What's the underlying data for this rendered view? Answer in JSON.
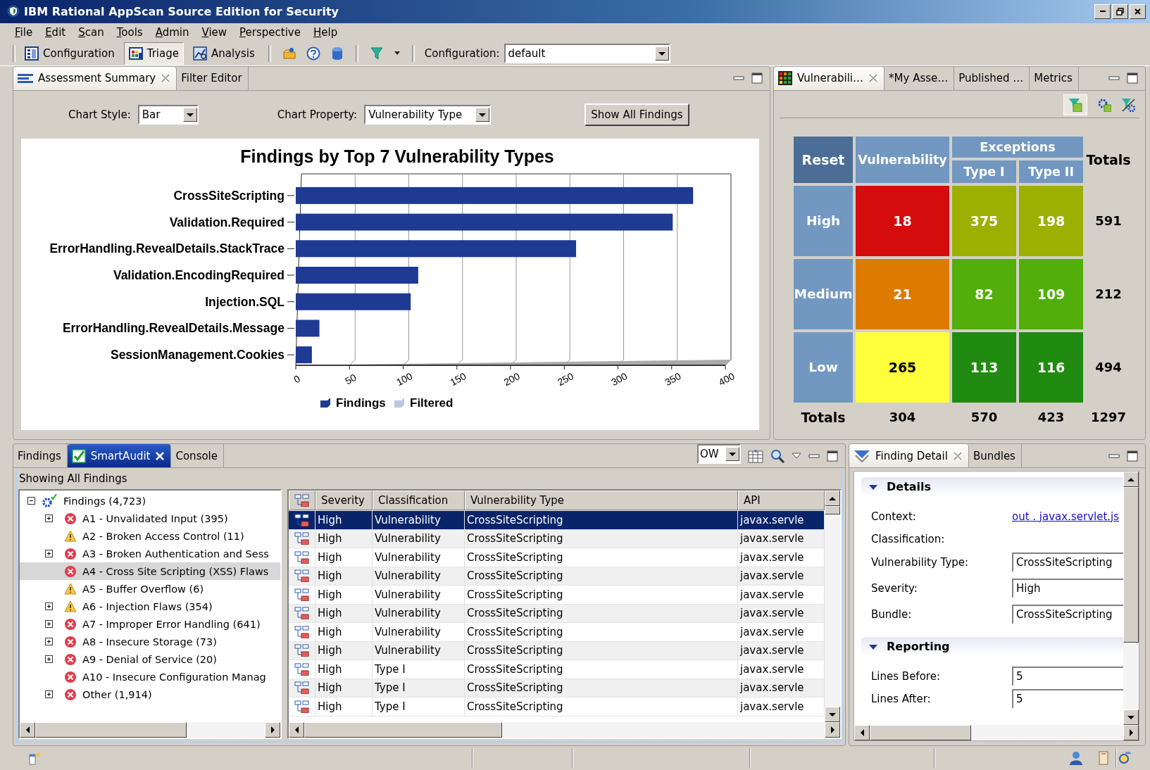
{
  "window": {
    "title": "IBM Rational AppScan Source Edition for Security"
  },
  "menu": [
    "File",
    "Edit",
    "Scan",
    "Tools",
    "Admin",
    "View",
    "Perspective",
    "Help"
  ],
  "toolbar": {
    "perspectives": [
      {
        "label": "Configuration",
        "kind": "configuration",
        "selected": false
      },
      {
        "label": "Triage",
        "kind": "triage",
        "selected": true
      },
      {
        "label": "Analysis",
        "kind": "analysis",
        "selected": false
      }
    ],
    "configuration_label": "Configuration:",
    "configuration_value": "default"
  },
  "summary_panel": {
    "active": false,
    "tabs": [
      {
        "label": "Assessment Summary",
        "selected": true,
        "closable": true
      },
      {
        "label": "Filter Editor",
        "selected": false,
        "closable": false
      }
    ],
    "chart_style_label": "Chart Style:",
    "chart_style": "Bar",
    "chart_property_label": "Chart Property:",
    "chart_property": "Vulnerability Type",
    "show_all_button": "Show All Findings",
    "chart_data": {
      "type": "bar",
      "orientation": "horizontal",
      "title": "Findings by Top 7 Vulnerability Types",
      "categories": [
        "CrossSiteScripting",
        "Validation.Required",
        "ErrorHandling.RevealDetails.StackTrace",
        "Validation.EncodingRequired",
        "Injection.SQL",
        "ErrorHandling.RevealDetails.Message",
        "SessionManagement.Cookies"
      ],
      "series": [
        {
          "name": "Findings",
          "color": "#1f3a93",
          "values": [
            370,
            351,
            261,
            114,
            107,
            22,
            15
          ]
        },
        {
          "name": "Filtered",
          "color": "#b9c6e6",
          "values": [
            0,
            0,
            0,
            0,
            0,
            0,
            0
          ]
        }
      ],
      "xlim": [
        0,
        400
      ],
      "xticks": [
        0,
        50,
        100,
        150,
        200,
        250,
        300,
        350,
        400
      ]
    }
  },
  "matrix_panel": {
    "active": false,
    "tabs": [
      {
        "label": "Vulnerabili…",
        "selected": true,
        "closable": true
      },
      {
        "label": "*My Asse…",
        "selected": false,
        "closable": false
      },
      {
        "label": "Published …",
        "selected": false,
        "closable": false
      },
      {
        "label": "Metrics",
        "selected": false,
        "closable": false
      }
    ],
    "matrix": {
      "reset": "Reset",
      "vulnerability": "Vulnerability",
      "exceptions": "Exceptions",
      "type_1": "Type I",
      "type_2": "Type II",
      "totals": "Totals",
      "rows": [
        {
          "label": "High",
          "cells": [
            {
              "value": "18",
              "color": "#d40c0c"
            },
            {
              "value": "375",
              "color": "#9bb000"
            },
            {
              "value": "198",
              "color": "#9bb000"
            }
          ],
          "total": "591"
        },
        {
          "label": "Medium",
          "cells": [
            {
              "value": "21",
              "color": "#dd7b00"
            },
            {
              "value": "82",
              "color": "#52ae0a"
            },
            {
              "value": "109",
              "color": "#52ae0a"
            }
          ],
          "total": "212"
        },
        {
          "label": "Low",
          "cells": [
            {
              "value": "265",
              "color": "#ffff3c"
            },
            {
              "value": "113",
              "color": "#208b10"
            },
            {
              "value": "116",
              "color": "#208b10"
            }
          ],
          "total": "494"
        }
      ],
      "totals_row": {
        "label": "Totals",
        "values": [
          "304",
          "570",
          "423",
          "1297"
        ]
      }
    }
  },
  "findings_panel": {
    "active": true,
    "tabs": [
      {
        "label": "Findings",
        "selected": false,
        "closable": false
      },
      {
        "label": "SmartAudit",
        "selected": true,
        "closable": true
      },
      {
        "label": "Console",
        "selected": false,
        "closable": false
      }
    ],
    "view_combo": "OW",
    "heading": "Showing All Findings",
    "tree": {
      "label": "Findings (4,723)",
      "expanded": true,
      "children": [
        {
          "label": "A1 - Unvalidated Input (395)",
          "kind": "error",
          "expandable": true,
          "selected": false
        },
        {
          "label": "A2 - Broken Access Control (11)",
          "kind": "warning",
          "expandable": false,
          "selected": false
        },
        {
          "label": "A3 - Broken Authentication and Sess",
          "kind": "error",
          "expandable": true,
          "selected": false
        },
        {
          "label": "A4 - Cross Site Scripting (XSS) Flaws",
          "kind": "error",
          "expandable": false,
          "selected": true
        },
        {
          "label": "A5 - Buffer Overflow (6)",
          "kind": "warning",
          "expandable": false,
          "selected": false
        },
        {
          "label": "A6 - Injection Flaws (354)",
          "kind": "warning",
          "expandable": true,
          "selected": false
        },
        {
          "label": "A7 - Improper Error Handling (641)",
          "kind": "error",
          "expandable": true,
          "selected": false
        },
        {
          "label": "A8 - Insecure Storage (73)",
          "kind": "error",
          "expandable": true,
          "selected": false
        },
        {
          "label": "A9 - Denial of Service (20)",
          "kind": "error",
          "expandable": true,
          "selected": false
        },
        {
          "label": "A10 - Insecure Configuration Manag",
          "kind": "error",
          "expandable": false,
          "selected": false
        },
        {
          "label": "Other (1,914)",
          "kind": "error",
          "expandable": true,
          "selected": false
        }
      ]
    },
    "table": {
      "columns": [
        "Severity",
        "Classification",
        "Vulnerability Type",
        "API"
      ],
      "rows": [
        {
          "severity": "High",
          "classification": "Vulnerability",
          "vulnerability_type": "CrossSiteScripting",
          "api": "javax.servle",
          "selected": true
        },
        {
          "severity": "High",
          "classification": "Vulnerability",
          "vulnerability_type": "CrossSiteScripting",
          "api": "javax.servle",
          "selected": false
        },
        {
          "severity": "High",
          "classification": "Vulnerability",
          "vulnerability_type": "CrossSiteScripting",
          "api": "javax.servle",
          "selected": false
        },
        {
          "severity": "High",
          "classification": "Vulnerability",
          "vulnerability_type": "CrossSiteScripting",
          "api": "javax.servle",
          "selected": false
        },
        {
          "severity": "High",
          "classification": "Vulnerability",
          "vulnerability_type": "CrossSiteScripting",
          "api": "javax.servle",
          "selected": false
        },
        {
          "severity": "High",
          "classification": "Vulnerability",
          "vulnerability_type": "CrossSiteScripting",
          "api": "javax.servle",
          "selected": false
        },
        {
          "severity": "High",
          "classification": "Vulnerability",
          "vulnerability_type": "CrossSiteScripting",
          "api": "javax.servle",
          "selected": false
        },
        {
          "severity": "High",
          "classification": "Vulnerability",
          "vulnerability_type": "CrossSiteScripting",
          "api": "javax.servle",
          "selected": false
        },
        {
          "severity": "High",
          "classification": "Type I",
          "vulnerability_type": "CrossSiteScripting",
          "api": "javax.servle",
          "selected": false
        },
        {
          "severity": "High",
          "classification": "Type I",
          "vulnerability_type": "CrossSiteScripting",
          "api": "javax.servle",
          "selected": false
        },
        {
          "severity": "High",
          "classification": "Type I",
          "vulnerability_type": "CrossSiteScripting",
          "api": "javax.servle",
          "selected": false
        }
      ]
    }
  },
  "detail_panel": {
    "active": false,
    "tabs": [
      {
        "label": "Finding Detail",
        "selected": true,
        "closable": true
      },
      {
        "label": "Bundles",
        "selected": false,
        "closable": false
      }
    ],
    "sections": [
      {
        "title": "Details",
        "expanded": true,
        "fields": [
          {
            "label": "Context:",
            "kind": "link",
            "value": "out . javax.servlet.js"
          },
          {
            "label": "Classification:",
            "kind": "label"
          },
          {
            "label": "Vulnerability Type:",
            "kind": "text",
            "value": "CrossSiteScripting"
          },
          {
            "label": "Severity:",
            "kind": "text",
            "value": "High"
          },
          {
            "label": "Bundle:",
            "kind": "text",
            "value": "CrossSiteScripting"
          }
        ]
      },
      {
        "title": "Reporting",
        "expanded": true,
        "fields": [
          {
            "label": "Lines Before:",
            "kind": "text",
            "value": "5"
          },
          {
            "label": "Lines After:",
            "kind": "text",
            "value": "5"
          }
        ]
      }
    ]
  }
}
